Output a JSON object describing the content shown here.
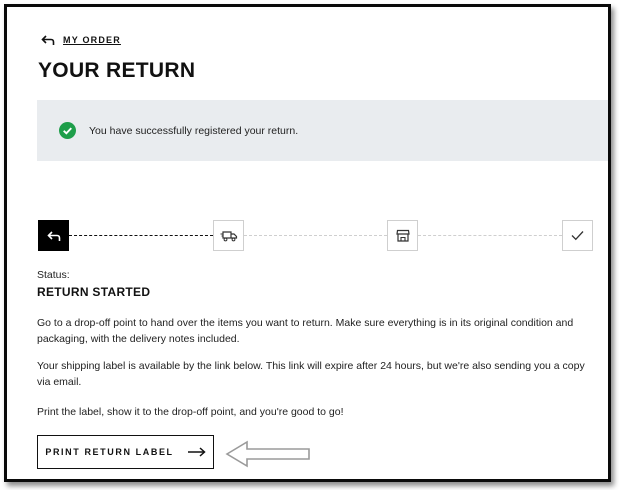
{
  "header": {
    "back_label": "MY ORDER",
    "title": "YOUR RETURN"
  },
  "notice": {
    "message": "You have successfully registered your return.",
    "icon": "check-circle-icon",
    "icon_color": "#1e9e4a"
  },
  "tracker": {
    "steps": [
      {
        "icon": "return-arrow-icon",
        "state": "active"
      },
      {
        "icon": "delivery-truck-icon",
        "state": "pending"
      },
      {
        "icon": "store-icon",
        "state": "pending"
      },
      {
        "icon": "checkmark-icon",
        "state": "pending"
      }
    ]
  },
  "status": {
    "label": "Status:",
    "value": "RETURN STARTED"
  },
  "body": {
    "paragraph1": "Go to a drop-off point to hand over the items you want to return. Make sure everything is in its original condition and packaging, with the delivery notes included.",
    "paragraph2": "Your shipping label is available by the link below. This link will expire after 24 hours, but we're also sending you a copy via email.",
    "paragraph3": "Print the label, show it to the drop-off point, and you're good to go!"
  },
  "actions": {
    "print_label": "PRINT RETURN LABEL"
  },
  "colors": {
    "success_bg": "#e9ecef",
    "active_step": "#000000",
    "callout_arrow": "#bdbdbd"
  }
}
